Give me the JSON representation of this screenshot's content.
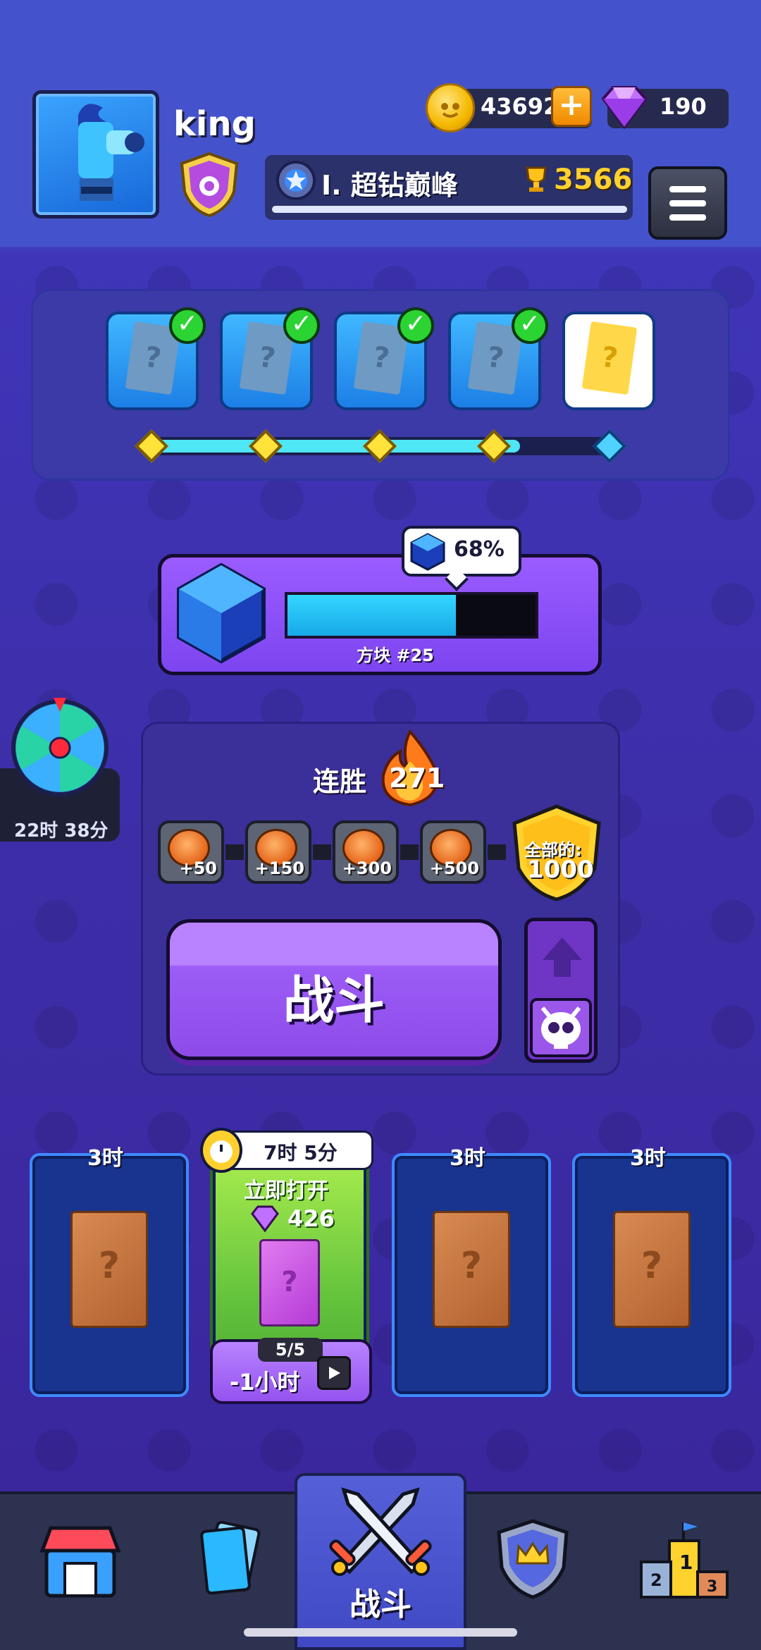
{
  "player": {
    "name": "king",
    "avatar_icon": "blue-flame-cannon-avatar",
    "badge_icon": "purple-shield-icon"
  },
  "currency": {
    "coins": "43692",
    "gems": "190"
  },
  "rank": {
    "name": "I. 超钻巅峰",
    "trophies": "3566"
  },
  "pass_track": {
    "cards": [
      {
        "state": "claimed",
        "label": "?"
      },
      {
        "state": "claimed",
        "label": "?"
      },
      {
        "state": "claimed",
        "label": "?"
      },
      {
        "state": "claimed",
        "label": "?"
      },
      {
        "state": "available",
        "label": "?"
      }
    ],
    "progress_fraction": 0.8
  },
  "block_progress": {
    "percent_label": "68%",
    "percent": 68,
    "label": "方块 #25"
  },
  "spin_wheel": {
    "timer": "22时 38分"
  },
  "win_streak": {
    "label": "连胜",
    "value": "271",
    "rewards": [
      "+50",
      "+150",
      "+300",
      "+500"
    ],
    "total_label": "全部的:",
    "total_value": "1000"
  },
  "battle_button": {
    "label": "战斗"
  },
  "chest_slots": [
    {
      "time": "3时",
      "pack": "?"
    },
    {
      "timer": "7时 5分",
      "open_now": "立即打开",
      "gem_cost": "426",
      "pack": "?",
      "count": "5/5",
      "speed_up": "-1小时"
    },
    {
      "time": "3时",
      "pack": "?"
    },
    {
      "time": "3时",
      "pack": "?"
    }
  ],
  "bottom_nav": {
    "items": [
      {
        "name": "shop",
        "icon": "shop-icon"
      },
      {
        "name": "cards",
        "icon": "cards-icon"
      },
      {
        "name": "battle",
        "icon": "crossed-swords-icon",
        "label": "战斗"
      },
      {
        "name": "clan",
        "icon": "crown-shield-icon"
      },
      {
        "name": "leaderboard",
        "icon": "podium-icon"
      }
    ]
  },
  "colors": {
    "accent_purple": "#9c5cf6",
    "coin_gold": "#f5b800",
    "progress_cyan": "#33d7ff",
    "check_green": "#2bd433"
  }
}
